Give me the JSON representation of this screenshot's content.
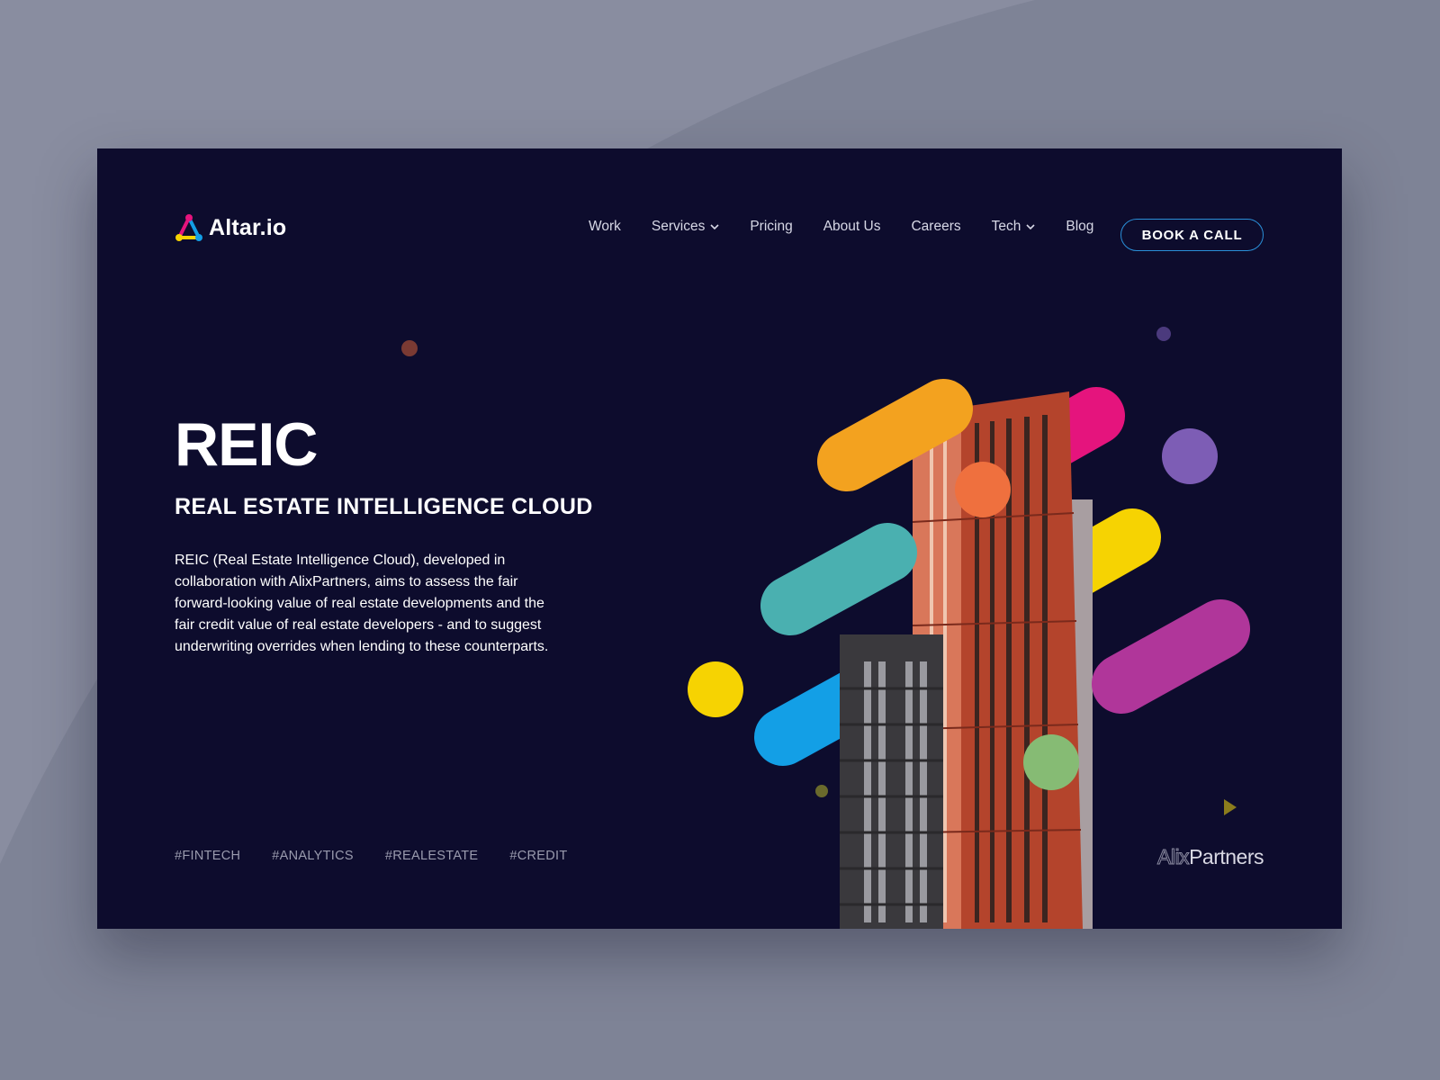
{
  "brand": {
    "name": "Altar.io"
  },
  "nav": {
    "items": [
      {
        "label": "Work",
        "dropdown": false
      },
      {
        "label": "Services",
        "dropdown": true
      },
      {
        "label": "Pricing",
        "dropdown": false
      },
      {
        "label": "About Us",
        "dropdown": false
      },
      {
        "label": "Careers",
        "dropdown": false
      },
      {
        "label": "Tech",
        "dropdown": true
      },
      {
        "label": "Blog",
        "dropdown": false
      }
    ],
    "cta_label": "BOOK A CALL"
  },
  "hero": {
    "title": "REIC",
    "subtitle": "REAL ESTATE INTELLIGENCE CLOUD",
    "description": "REIC (Real Estate Intelligence Cloud), developed in collaboration with AlixPartners, aims to assess the fair forward-looking value of real estate developments and the fair credit value of real estate developers - and to suggest underwriting overrides when lending to these counterparts."
  },
  "tags": [
    "#FINTECH",
    "#ANALYTICS",
    "#REALESTATE",
    "#CREDIT"
  ],
  "partner": {
    "name_part1": "Alix",
    "name_part2": "Partners"
  },
  "colors": {
    "page_bg": "#7e8396",
    "frame_bg": "#0d0c2d",
    "cta_border": "#2a8fd8",
    "orange": "#f3a21f",
    "pink": "#e5147d",
    "teal": "#4ab0b0",
    "yellow": "#f6d302",
    "magenta": "#b0369a",
    "blue": "#139fe6",
    "purple": "#7d5db5",
    "green": "#86bb74",
    "coral": "#ef703e"
  },
  "icons": [
    "altar-logo-icon",
    "chevron-down-icon",
    "play-triangle-icon"
  ]
}
